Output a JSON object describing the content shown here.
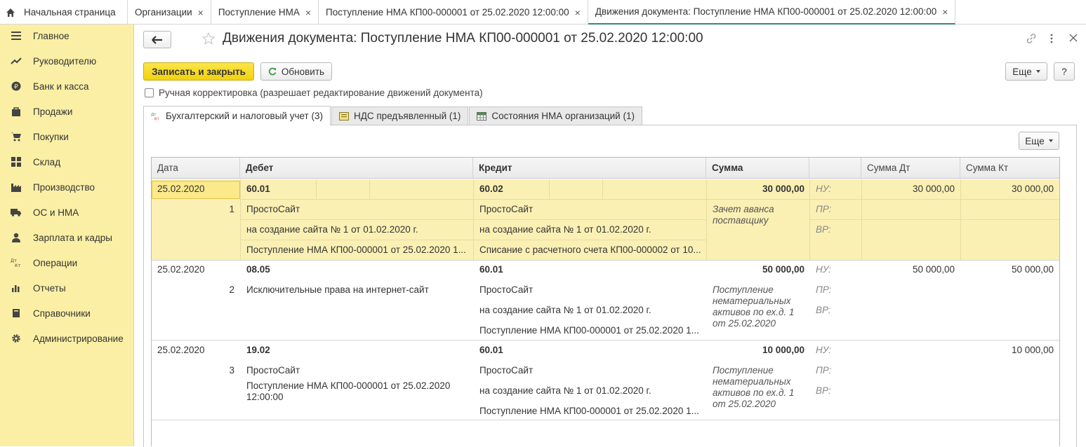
{
  "tabs": [
    {
      "label": "Начальная страница",
      "icon": "home-icon"
    },
    {
      "label": "Организации"
    },
    {
      "label": "Поступление НМА"
    },
    {
      "label": "Поступление НМА КП00-000001 от 25.02.2020 12:00:00"
    },
    {
      "label": "Движения документа: Поступление НМА КП00-000001 от 25.02.2020 12:00:00",
      "active": true
    }
  ],
  "sidebar": {
    "items": [
      {
        "label": "Главное",
        "icon": "menu-icon"
      },
      {
        "label": "Руководителю",
        "icon": "trend-icon"
      },
      {
        "label": "Банк и касса",
        "icon": "ruble-icon"
      },
      {
        "label": "Продажи",
        "icon": "bag-icon"
      },
      {
        "label": "Покупки",
        "icon": "cart-icon"
      },
      {
        "label": "Склад",
        "icon": "warehouse-icon"
      },
      {
        "label": "Производство",
        "icon": "factory-icon"
      },
      {
        "label": "ОС и НМА",
        "icon": "truck-icon"
      },
      {
        "label": "Зарплата и кадры",
        "icon": "person-icon"
      },
      {
        "label": "Операции",
        "icon": "dt-kt-icon"
      },
      {
        "label": "Отчеты",
        "icon": "bar-chart-icon"
      },
      {
        "label": "Справочники",
        "icon": "book-icon"
      },
      {
        "label": "Администрирование",
        "icon": "gear-icon"
      }
    ]
  },
  "header": {
    "title": "Движения документа: Поступление НМА КП00-000001 от 25.02.2020 12:00:00"
  },
  "toolbar": {
    "save_close": "Записать и закрыть",
    "refresh": "Обновить",
    "more": "Еще",
    "help": "?"
  },
  "manual_edit": {
    "label": "Ручная корректировка (разрешает редактирование движений документа)",
    "checked": false
  },
  "subtabs": [
    {
      "label": "Бухгалтерский и налоговый учет (3)",
      "active": true
    },
    {
      "label": "НДС предъявленный (1)"
    },
    {
      "label": "Состояния НМА организаций (1)"
    }
  ],
  "grid_more": "Еще",
  "columns": {
    "date": "Дата",
    "debit": "Дебет",
    "credit": "Кредит",
    "sum": "Сумма",
    "sum_dt": "Сумма Дт",
    "sum_kt": "Сумма Кт"
  },
  "records": [
    {
      "date": "25.02.2020",
      "num": "1",
      "debit_account": "60.01",
      "debit_sub": [
        "ПростоСайт",
        "на создание сайта № 1 от 01.02.2020 г.",
        "Поступление НМА КП00-000001 от 25.02.2020 1..."
      ],
      "credit_account": "60.02",
      "credit_sub": [
        "ПростоСайт",
        "на создание сайта № 1 от 01.02.2020 г.",
        "Списание с расчетного счета КП00-000002 от 10..."
      ],
      "sum": "30 000,00",
      "content": "Зачет аванса поставщику",
      "labels": [
        "НУ:",
        "ПР:",
        "ВР:"
      ],
      "sum_dt": "30 000,00",
      "sum_kt": "30 000,00"
    },
    {
      "date": "25.02.2020",
      "num": "2",
      "debit_account": "08.05",
      "debit_sub": [
        "Исключительные права на интернет-сайт"
      ],
      "credit_account": "60.01",
      "credit_sub": [
        "ПростоСайт",
        "на создание сайта № 1 от 01.02.2020 г.",
        "Поступление НМА КП00-000001 от 25.02.2020 1..."
      ],
      "sum": "50 000,00",
      "content": "Поступление нематериальных активов по ех.д. 1 от 25.02.2020",
      "labels": [
        "НУ:",
        "ПР:",
        "ВР:"
      ],
      "sum_dt": "50 000,00",
      "sum_kt": "50 000,00"
    },
    {
      "date": "25.02.2020",
      "num": "3",
      "debit_account": "19.02",
      "debit_sub": [
        "ПростоСайт",
        "Поступление НМА КП00-000001 от 25.02.2020 12:00:00"
      ],
      "credit_account": "60.01",
      "credit_sub": [
        "ПростоСайт",
        "на создание сайта № 1 от 01.02.2020 г.",
        "Поступление НМА КП00-000001 от 25.02.2020 1..."
      ],
      "sum": "10 000,00",
      "content": "Поступление нематериальных активов по ех.д. 1 от 25.02.2020",
      "labels": [
        "НУ:",
        "ПР:",
        "ВР:"
      ],
      "sum_dt": "",
      "sum_kt": "10 000,00"
    }
  ]
}
